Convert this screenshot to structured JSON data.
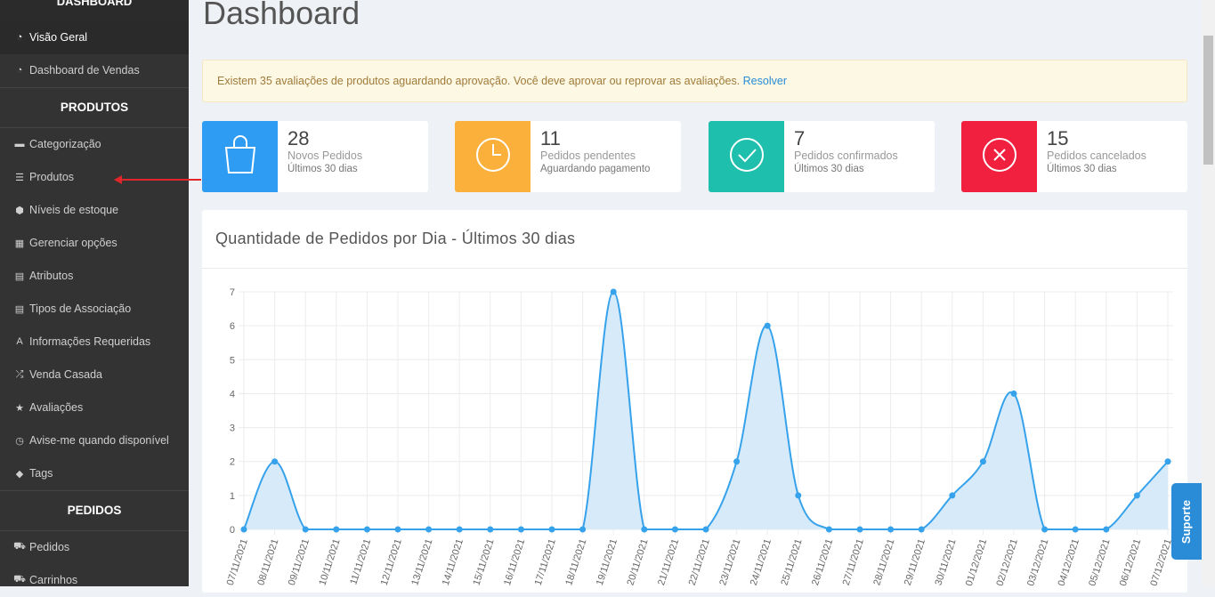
{
  "sidebar": {
    "top_header": "DASHBOARD",
    "items_top": [
      {
        "label": "Visão Geral",
        "icon": "speedometer-icon",
        "active": true
      },
      {
        "label": "Dashboard de Vendas",
        "icon": "speedometer-icon",
        "active": false
      }
    ],
    "section_produtos": "PRODUTOS",
    "items_produtos": [
      {
        "label": "Categorização",
        "icon": "folder-icon"
      },
      {
        "label": "Produtos",
        "icon": "list-icon"
      },
      {
        "label": "Níveis de estoque",
        "icon": "cubes-icon"
      },
      {
        "label": "Gerenciar opções",
        "icon": "grid-icon"
      },
      {
        "label": "Atributos",
        "icon": "table-icon"
      },
      {
        "label": "Tipos de Associação",
        "icon": "list-alt-icon"
      },
      {
        "label": "Informações Requeridas",
        "icon": "font-icon"
      },
      {
        "label": "Venda Casada",
        "icon": "shuffle-icon"
      },
      {
        "label": "Avaliações",
        "icon": "star-icon"
      },
      {
        "label": "Avise-me quando disponível",
        "icon": "clock-icon"
      },
      {
        "label": "Tags",
        "icon": "tag-icon"
      }
    ],
    "section_pedidos": "PEDIDOS",
    "items_pedidos": [
      {
        "label": "Pedidos",
        "icon": "cart-icon"
      },
      {
        "label": "Carrinhos",
        "icon": "cart-icon"
      }
    ]
  },
  "main": {
    "title": "Dashboard",
    "alert": {
      "text": "Existem 35 avaliações de produtos aguardando aprovação. Você deve aprovar ou reprovar as avaliações.",
      "link": "Resolver"
    },
    "stats": [
      {
        "number": "28",
        "label": "Novos Pedidos",
        "sub": "Últimos 30 dias",
        "color": "#2e9cf3",
        "icon": "shopping-bag-icon"
      },
      {
        "number": "11",
        "label": "Pedidos pendentes",
        "sub": "Aguardando pagamento",
        "color": "#fbb03b",
        "icon": "clock-icon"
      },
      {
        "number": "7",
        "label": "Pedidos confirmados",
        "sub": "Últimos 30 dias",
        "color": "#1fbfad",
        "icon": "check-circle-icon"
      },
      {
        "number": "15",
        "label": "Pedidos cancelados",
        "sub": "Últimos 30 dias",
        "color": "#f0203e",
        "icon": "x-circle-icon"
      }
    ]
  },
  "support_label": "Suporte",
  "chart_data": {
    "type": "area",
    "title": "Quantidade de Pedidos por Dia - Últimos 30 dias",
    "x": [
      "07/11/2021",
      "08/11/2021",
      "09/11/2021",
      "10/11/2021",
      "11/11/2021",
      "12/11/2021",
      "13/11/2021",
      "14/11/2021",
      "15/11/2021",
      "16/11/2021",
      "17/11/2021",
      "18/11/2021",
      "19/11/2021",
      "20/11/2021",
      "21/11/2021",
      "22/11/2021",
      "23/11/2021",
      "24/11/2021",
      "25/11/2021",
      "26/11/2021",
      "27/11/2021",
      "28/11/2021",
      "29/11/2021",
      "30/11/2021",
      "01/12/2021",
      "02/12/2021",
      "03/12/2021",
      "04/12/2021",
      "05/12/2021",
      "06/12/2021",
      "07/12/2021"
    ],
    "values": [
      0,
      2,
      0,
      0,
      0,
      0,
      0,
      0,
      0,
      0,
      0,
      0,
      7,
      0,
      0,
      0,
      2,
      6,
      1,
      0,
      0,
      0,
      0,
      1,
      2,
      4,
      0,
      0,
      0,
      1,
      2
    ],
    "yticks": [
      0,
      1,
      2,
      3,
      4,
      5,
      6,
      7
    ],
    "ylim": [
      0,
      7
    ],
    "grid": true,
    "color": "#36a2eb",
    "fill": "#d6eaf9"
  }
}
